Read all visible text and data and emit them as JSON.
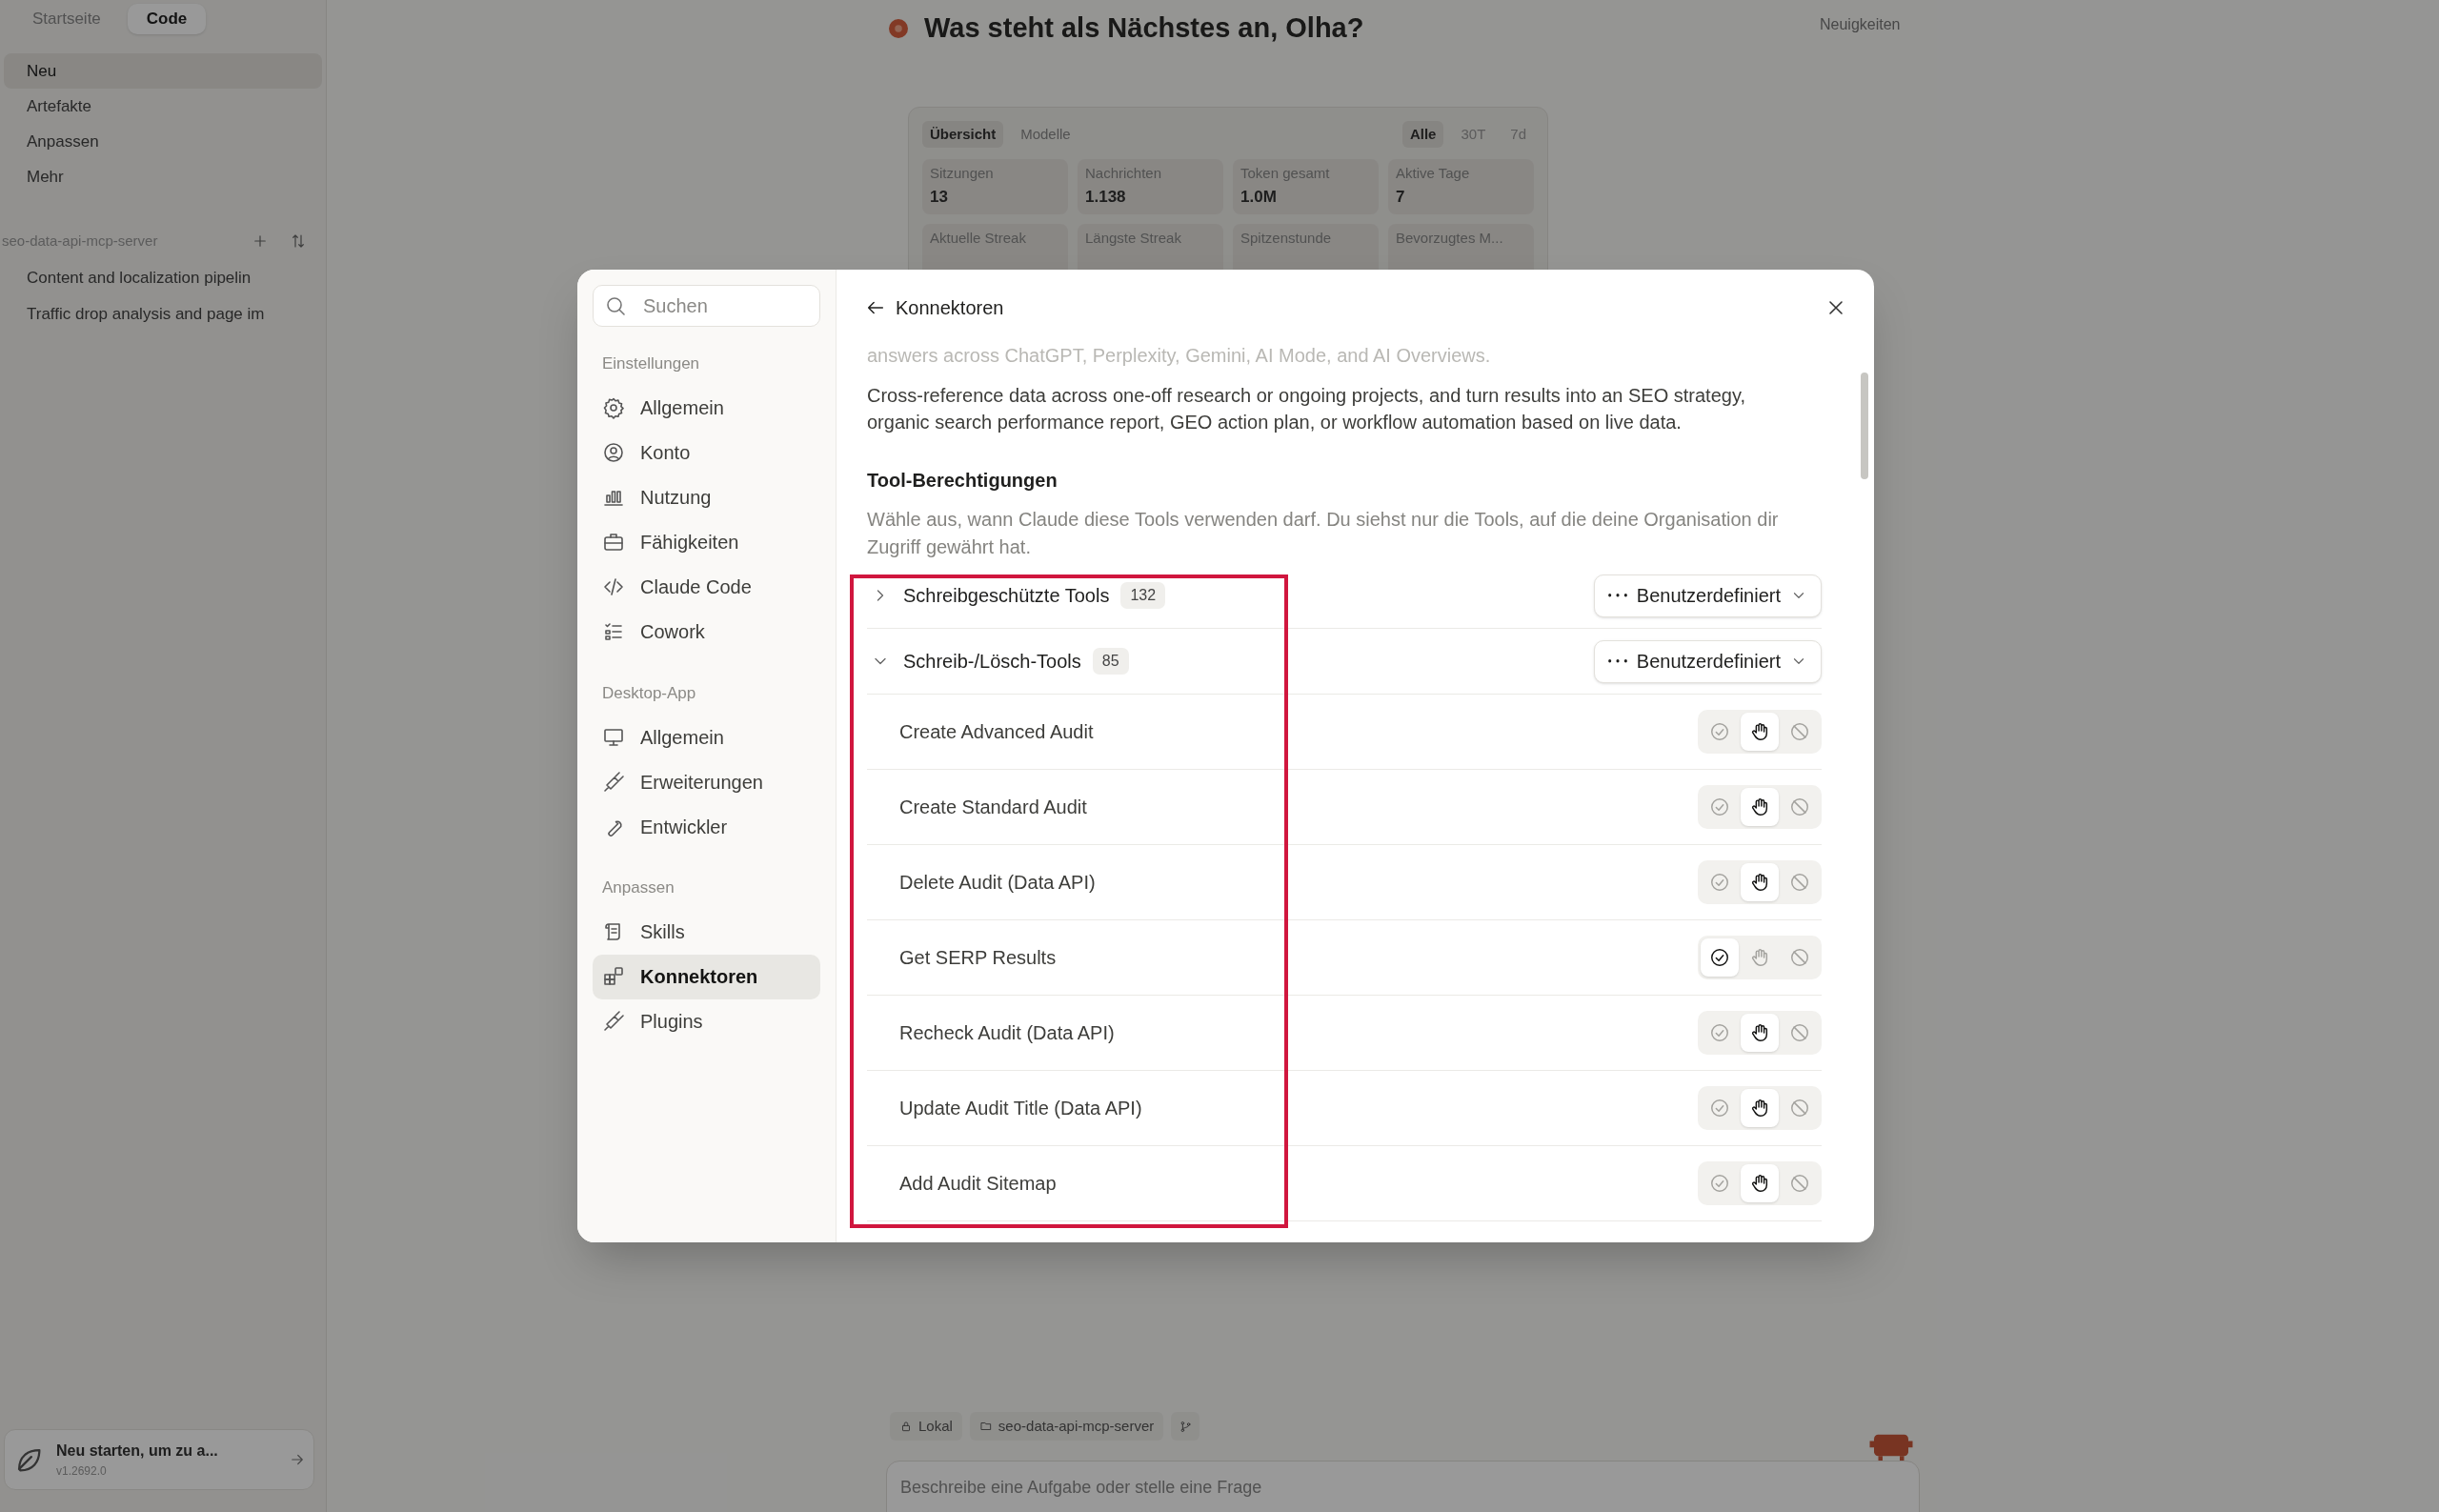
{
  "background": {
    "sidebar": {
      "tabs": [
        {
          "label": "Startseite",
          "selected": false
        },
        {
          "label": "Code",
          "selected": true
        }
      ],
      "items": [
        {
          "label": "Neu",
          "selected": true
        },
        {
          "label": "Artefakte",
          "selected": false
        },
        {
          "label": "Anpassen",
          "selected": false
        },
        {
          "label": "Mehr",
          "selected": false
        }
      ],
      "project": "seo-data-api-mcp-server",
      "chats": [
        "Content and localization pipelin",
        "Traffic drop analysis and page im"
      ],
      "update": {
        "title": "Neu starten, um zu a...",
        "version": "v1.2692.0"
      }
    },
    "header": {
      "greeting": "Was steht als Nächstes an, Olha?",
      "news": "Neuigkeiten"
    },
    "stats": {
      "tabs": [
        {
          "label": "Übersicht",
          "selected": true
        },
        {
          "label": "Modelle",
          "selected": false
        }
      ],
      "ranges": [
        {
          "label": "Alle",
          "selected": true
        },
        {
          "label": "30T",
          "selected": false
        },
        {
          "label": "7d",
          "selected": false
        }
      ],
      "cards": [
        {
          "label": "Sitzungen",
          "value": "13"
        },
        {
          "label": "Nachrichten",
          "value": "1.138"
        },
        {
          "label": "Token gesamt",
          "value": "1.0M"
        },
        {
          "label": "Aktive Tage",
          "value": "7"
        }
      ],
      "more_labels": [
        "Aktuelle Streak",
        "Längste Streak",
        "Spitzenstunde",
        "Bevorzugtes M..."
      ]
    },
    "composer": {
      "chips": [
        "Lokal",
        "seo-data-api-mcp-server"
      ],
      "placeholder": "Beschreibe eine Aufgabe oder stelle eine Frage"
    }
  },
  "modal": {
    "search": {
      "placeholder": "Suchen"
    },
    "sections": [
      {
        "title": "Einstellungen",
        "items": [
          {
            "label": "Allgemein",
            "selected": false
          },
          {
            "label": "Konto",
            "selected": false
          },
          {
            "label": "Nutzung",
            "selected": false
          },
          {
            "label": "Fähigkeiten",
            "selected": false
          },
          {
            "label": "Claude Code",
            "selected": false
          },
          {
            "label": "Cowork",
            "selected": false
          }
        ]
      },
      {
        "title": "Desktop-App",
        "items": [
          {
            "label": "Allgemein",
            "selected": false
          },
          {
            "label": "Erweiterungen",
            "selected": false
          },
          {
            "label": "Entwickler",
            "selected": false
          }
        ]
      },
      {
        "title": "Anpassen",
        "items": [
          {
            "label": "Skills",
            "selected": false
          },
          {
            "label": "Konnektoren",
            "selected": true
          },
          {
            "label": "Plugins",
            "selected": false
          }
        ]
      }
    ],
    "back_title": "Konnektoren",
    "faded_line": "answers across ChatGPT, Perplexity, Gemini, AI Mode, and AI Overviews.",
    "description": "Cross-reference data across one-off research or ongoing projects, and turn results into an SEO strategy, organic search performance report, GEO action plan, or workflow automation based on live data.",
    "permissions_title": "Tool-Berechtigungen",
    "permissions_hint": "Wähle aus, wann Claude diese Tools verwenden darf. Du siehst nur die Tools, auf die deine Organisation dir Zugriff gewährt hat.",
    "groups": [
      {
        "title": "Schreibgeschützte Tools",
        "count": "132",
        "mode": "Benutzerdefiniert",
        "expanded": false
      },
      {
        "title": "Schreib-/Lösch-Tools",
        "count": "85",
        "mode": "Benutzerdefiniert",
        "expanded": true,
        "tools": [
          {
            "name": "Create Advanced Audit",
            "options": [
              {
                "selected": false
              },
              {
                "selected": true
              },
              {
                "selected": false
              }
            ]
          },
          {
            "name": "Create Standard Audit",
            "options": [
              {
                "selected": false
              },
              {
                "selected": true
              },
              {
                "selected": false
              }
            ]
          },
          {
            "name": "Delete Audit (Data API)",
            "options": [
              {
                "selected": false
              },
              {
                "selected": true
              },
              {
                "selected": false
              }
            ]
          },
          {
            "name": "Get SERP Results",
            "options": [
              {
                "selected": true
              },
              {
                "selected": false
              },
              {
                "selected": false
              }
            ]
          },
          {
            "name": "Recheck Audit (Data API)",
            "options": [
              {
                "selected": false
              },
              {
                "selected": true
              },
              {
                "selected": false
              }
            ]
          },
          {
            "name": "Update Audit Title (Data API)",
            "options": [
              {
                "selected": false
              },
              {
                "selected": true
              },
              {
                "selected": false
              }
            ]
          },
          {
            "name": "Add Audit Sitemap",
            "options": [
              {
                "selected": false
              },
              {
                "selected": true
              },
              {
                "selected": false
              }
            ]
          }
        ]
      }
    ]
  }
}
